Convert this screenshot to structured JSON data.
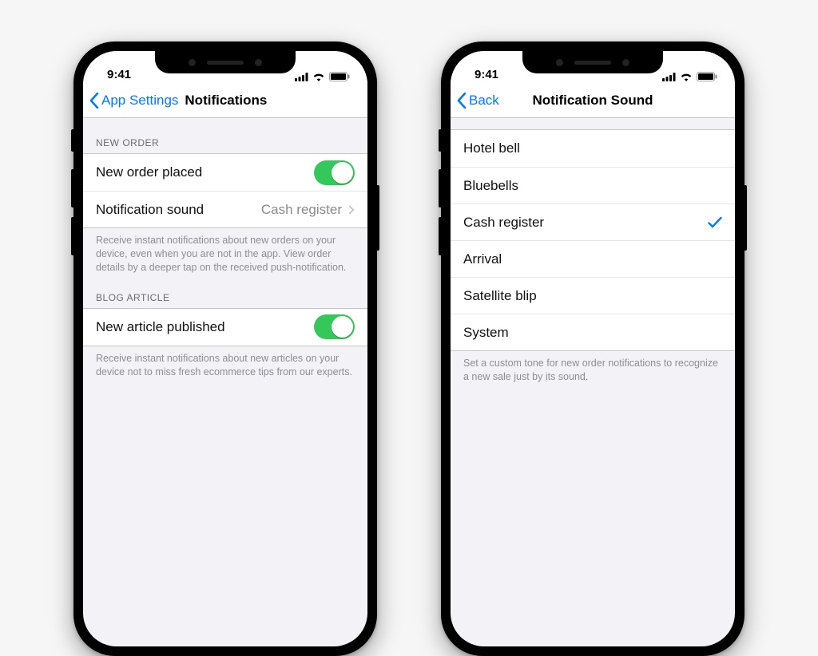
{
  "status": {
    "time": "9:41"
  },
  "phone1": {
    "nav": {
      "back": "App Settings",
      "title": "Notifications"
    },
    "sections": {
      "newOrder": {
        "header": "NEW ORDER",
        "rowToggle": "New order placed",
        "rowSound": "Notification sound",
        "rowSoundValue": "Cash register",
        "footer": "Receive instant notifications about new orders on your device, even when you are not in the app. View order details by a deeper tap on the received push-notification."
      },
      "blog": {
        "header": "BLOG ARTICLE",
        "rowToggle": "New article published",
        "footer": "Receive instant notifications about new articles on your device not to miss fresh ecommerce tips from our experts."
      }
    }
  },
  "phone2": {
    "nav": {
      "back": "Back",
      "title": "Notification Sound"
    },
    "sounds": {
      "o0": "Hotel bell",
      "o1": "Bluebells",
      "o2": "Cash register",
      "o3": "Arrival",
      "o4": "Satellite blip",
      "o5": "System",
      "selected": "Cash register"
    },
    "footer": "Set a custom tone for new order notifications to recognize a new sale just by its sound."
  }
}
